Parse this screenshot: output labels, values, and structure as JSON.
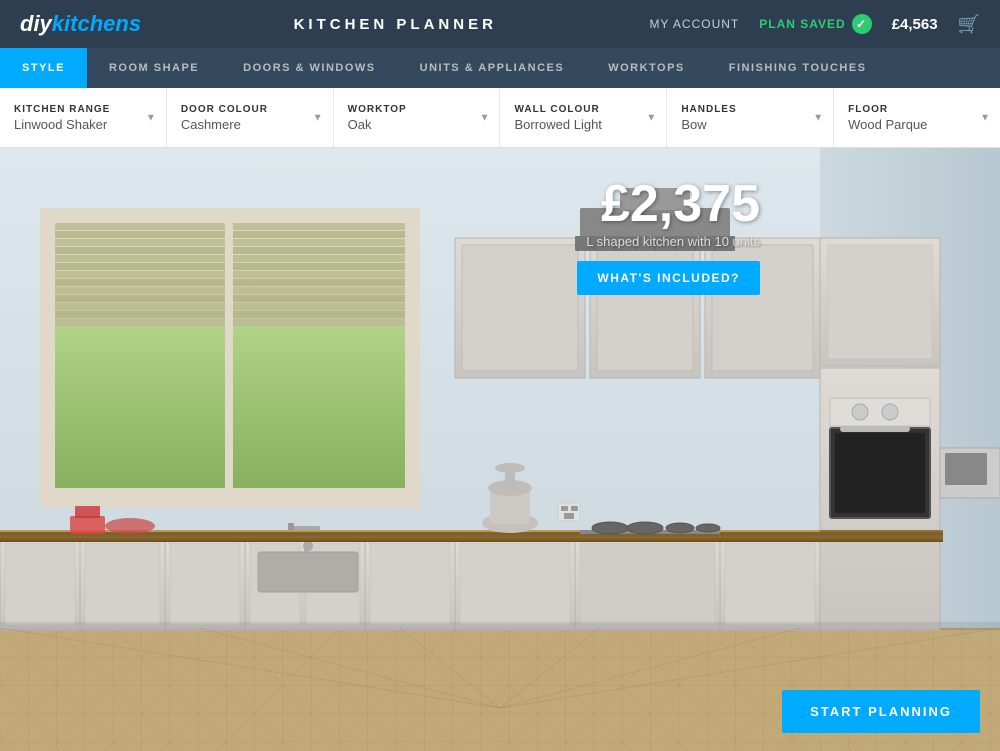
{
  "logo": {
    "diy": "diy",
    "kitchens": "kitchens"
  },
  "header": {
    "title": "KITCHEN PLANNER",
    "my_account": "MY ACCOUNT",
    "plan_saved": "PLAN SAVED",
    "price": "£4,563"
  },
  "tabs": [
    {
      "id": "style",
      "label": "STYLE",
      "active": true
    },
    {
      "id": "room-shape",
      "label": "ROOM SHAPE",
      "active": false
    },
    {
      "id": "doors-windows",
      "label": "DOORS & WINDOWS",
      "active": false
    },
    {
      "id": "units-appliances",
      "label": "UNITS & APPLIANCES",
      "active": false
    },
    {
      "id": "worktops",
      "label": "WORKTOPS",
      "active": false
    },
    {
      "id": "finishing-touches",
      "label": "FINISHING TOUCHES",
      "active": false
    }
  ],
  "options": [
    {
      "id": "kitchen-range",
      "label": "KITCHEN RANGE",
      "value": "Linwood Shaker"
    },
    {
      "id": "door-colour",
      "label": "DOOR COLOUR",
      "value": "Cashmere"
    },
    {
      "id": "worktop",
      "label": "WORKTOP",
      "value": "Oak"
    },
    {
      "id": "wall-colour",
      "label": "WALL COLOUR",
      "value": "Borrowed Light"
    },
    {
      "id": "handles",
      "label": "HANDLES",
      "value": "Bow"
    },
    {
      "id": "floor",
      "label": "FLOOR",
      "value": "Wood Parque"
    }
  ],
  "scene": {
    "price": "£2,375",
    "description": "L shaped kitchen with 10 units",
    "whats_included_label": "WHAT'S INCLUDED?",
    "start_planning_label": "START PLANNING"
  }
}
